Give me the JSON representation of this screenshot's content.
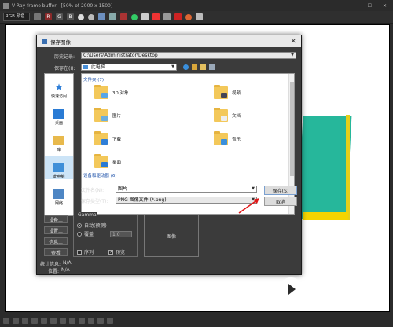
{
  "vfb": {
    "title": "V-Ray frame buffer - [50% of 2000 x 1500]",
    "channel": "RGB 颜色",
    "toolbar_letters": [
      "R",
      "G",
      "B"
    ]
  },
  "dialog": {
    "title": "保存图像",
    "history_label": "历史记录:",
    "history_value": "C:\\Users\\Administrator\\Desktop",
    "savein_label": "保存在(I):",
    "savein_value": "此电脑",
    "places": [
      "快速访问",
      "桌面",
      "库",
      "此电脑",
      "网络"
    ],
    "group_folders": "文件夹 (7)",
    "group_devices": "设备和驱动器 (6)",
    "folders": [
      "3D 对象",
      "视频",
      "图片",
      "文档",
      "下载",
      "音乐",
      "桌面"
    ],
    "filename_label": "文件名(N):",
    "filename_value": "图片",
    "filetype_label": "保存类型(T):",
    "filetype_value": "PNG 图像文件 (*.png)",
    "save_button": "保存(S)",
    "cancel_button": "取消",
    "setup_buttons": [
      "设备...",
      "设置...",
      "信息...",
      "查看"
    ],
    "gamma_title": "Gamma",
    "gamma_auto": "自动(预测)",
    "gamma_override": "覆盖",
    "gamma_value": "1.0",
    "sequence_label": "序列",
    "preview_label": "预览",
    "preview_box": "图像",
    "stats_label": "统计信息:",
    "stats_value": "N/A",
    "location_label": "位置:",
    "location_value": "N/A"
  },
  "watermark": {
    "brand": "溜溜自学",
    "url": "ZIXUE.3D66.COM"
  },
  "colors": {
    "teal": "#26b79b",
    "yellow": "#f4d400",
    "folder": "#f3c85a",
    "link_blue": "#1a4fa8"
  }
}
